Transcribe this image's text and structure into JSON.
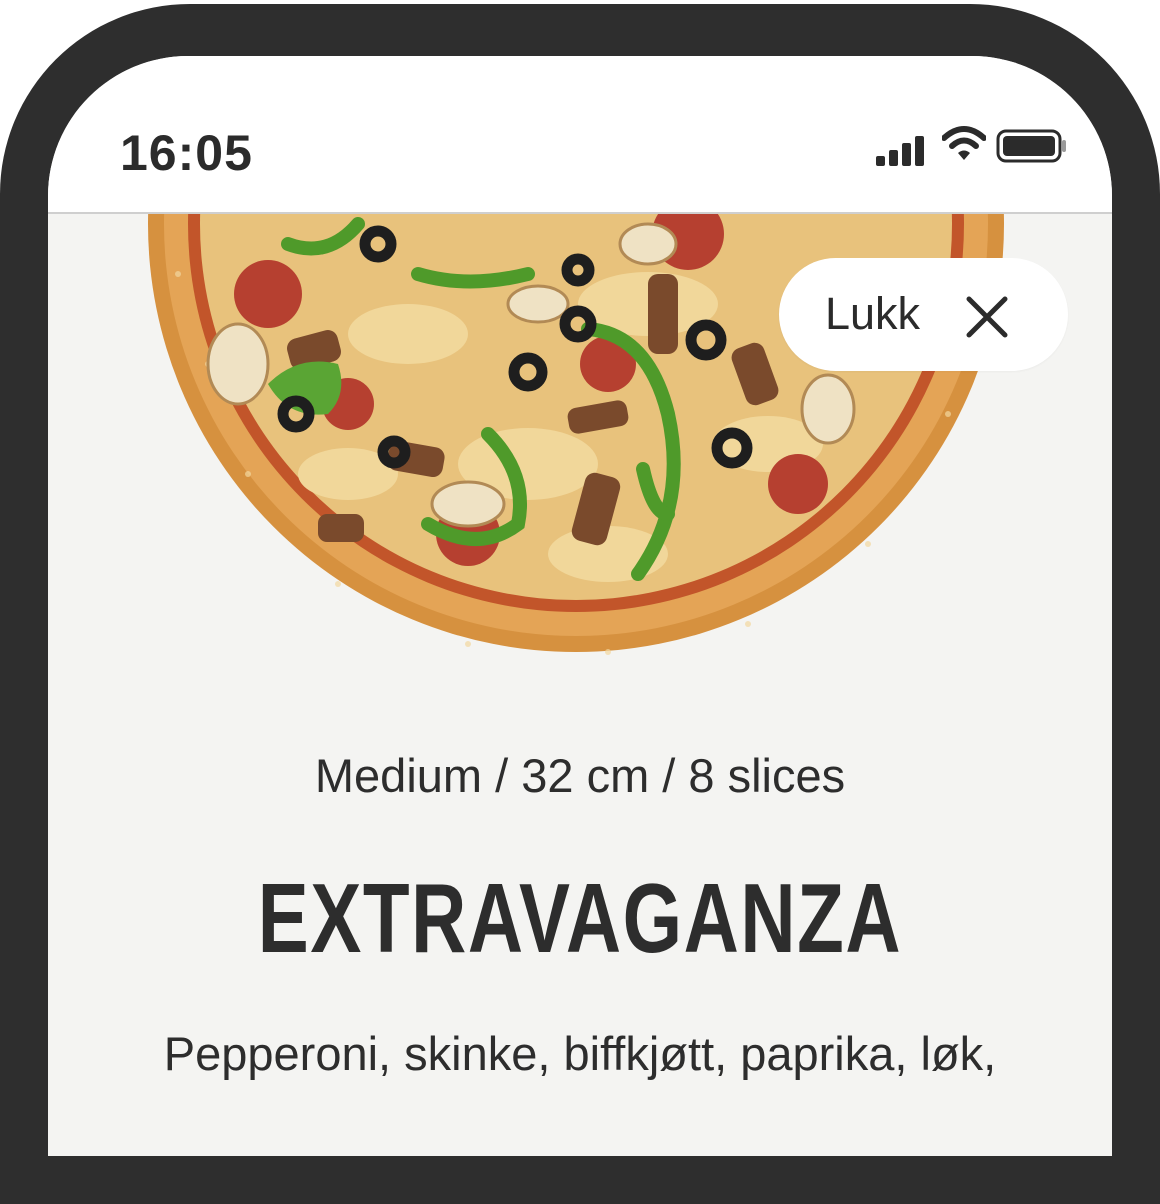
{
  "status_bar": {
    "time": "16:05",
    "icons": [
      "cellular-signal-icon",
      "wifi-icon",
      "battery-icon"
    ]
  },
  "image": {
    "name": "pizza-image",
    "alt": "Extravaganza pizza"
  },
  "close_button": {
    "label": "Lukk",
    "icon": "close-icon"
  },
  "product": {
    "size": "Medium / 32 cm / 8 slices",
    "title": "EXTRAVAGANZA",
    "ingredients": "Pepperoni, skinke, biffkjøtt, paprika, løk,"
  },
  "colors": {
    "frame": "#2e2e2e",
    "screen_background": "#f4f4f2",
    "text": "#2d2d2d",
    "crust": "#d9974a",
    "cheese": "#e9c884",
    "pepper": "#4f9a2a",
    "olive": "#1e1e1e"
  }
}
